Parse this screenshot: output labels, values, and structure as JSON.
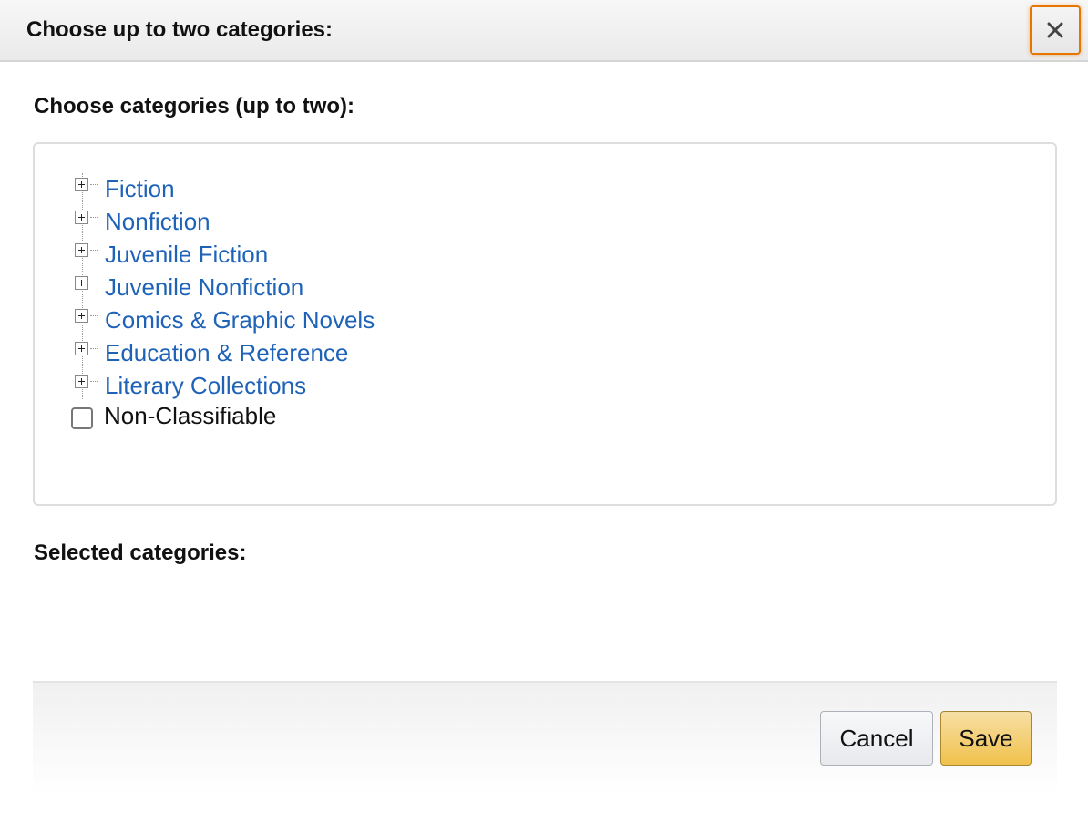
{
  "dialog": {
    "title": "Choose up to two categories:",
    "close_icon": "close-icon"
  },
  "chooser": {
    "label": "Choose categories (up to two):",
    "categories": [
      {
        "label": "Fiction",
        "icon": "expand-plus-icon"
      },
      {
        "label": "Nonfiction",
        "icon": "expand-plus-icon"
      },
      {
        "label": "Juvenile Fiction",
        "icon": "expand-plus-icon"
      },
      {
        "label": "Juvenile Nonfiction",
        "icon": "expand-plus-icon"
      },
      {
        "label": "Comics & Graphic Novels",
        "icon": "expand-plus-icon"
      },
      {
        "label": "Education & Reference",
        "icon": "expand-plus-icon"
      },
      {
        "label": "Literary Collections",
        "icon": "expand-plus-icon"
      }
    ],
    "non_classifiable": {
      "label": "Non-Classifiable",
      "checked": false
    }
  },
  "selected": {
    "label": "Selected categories:",
    "items": []
  },
  "footer": {
    "cancel_label": "Cancel",
    "save_label": "Save"
  },
  "colors": {
    "link": "#1f63b8",
    "save_button": "#f0c14b",
    "focus_ring": "#e77600"
  }
}
